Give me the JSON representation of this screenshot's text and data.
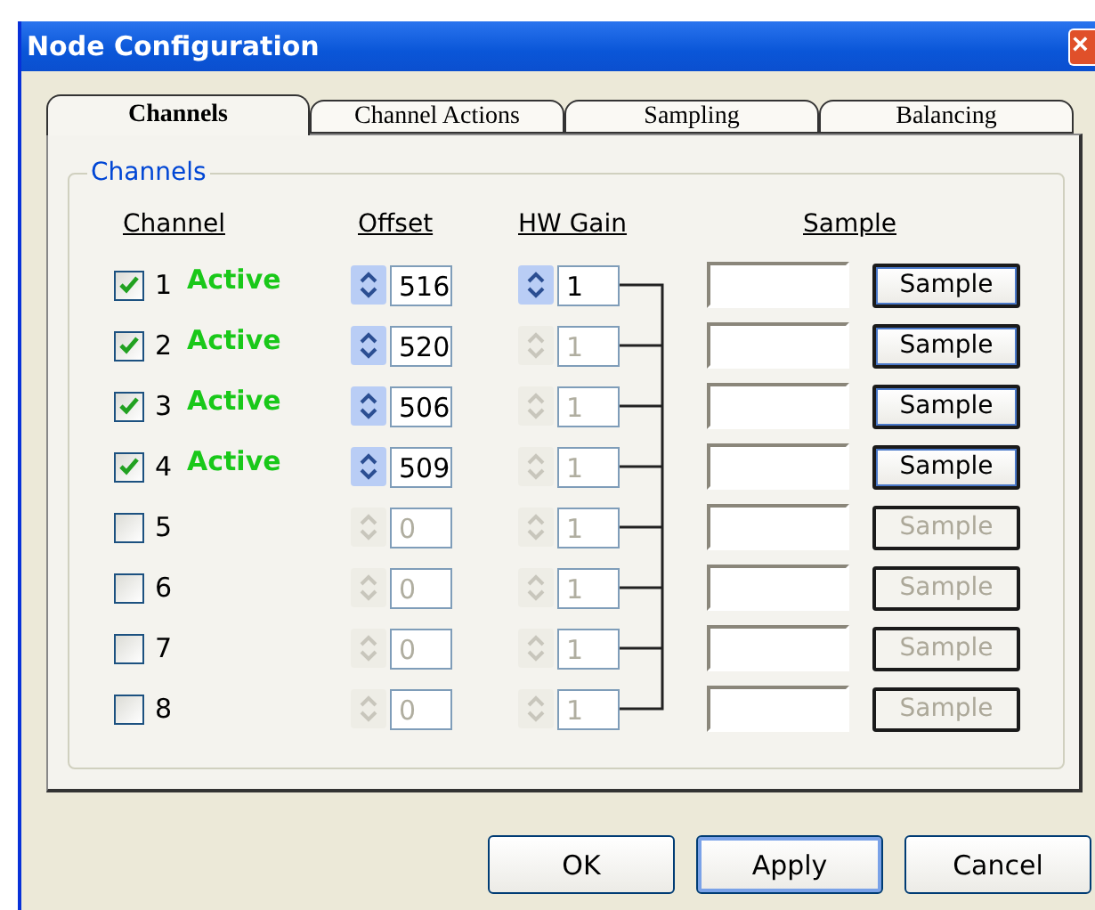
{
  "window": {
    "title": "Node Configuration",
    "close": "×"
  },
  "tabs": [
    {
      "label": "Channels",
      "selected": true
    },
    {
      "label": "Channel Actions",
      "selected": false
    },
    {
      "label": "Sampling",
      "selected": false
    },
    {
      "label": "Balancing",
      "selected": false
    }
  ],
  "group": {
    "title": "Channels",
    "columns": [
      "Channel",
      "Offset",
      "HW Gain",
      "Sample"
    ]
  },
  "channels": [
    {
      "number": "1",
      "checked": true,
      "status": "Active",
      "offset": {
        "value": "516",
        "disabled": false
      },
      "gain": {
        "value": "1",
        "disabled": false
      },
      "sample_button": {
        "label": "Sample",
        "disabled": false
      }
    },
    {
      "number": "2",
      "checked": true,
      "status": "Active",
      "offset": {
        "value": "520",
        "disabled": false
      },
      "gain": {
        "value": "1",
        "disabled": true
      },
      "sample_button": {
        "label": "Sample",
        "disabled": false
      }
    },
    {
      "number": "3",
      "checked": true,
      "status": "Active",
      "offset": {
        "value": "506",
        "disabled": false
      },
      "gain": {
        "value": "1",
        "disabled": true
      },
      "sample_button": {
        "label": "Sample",
        "disabled": false
      }
    },
    {
      "number": "4",
      "checked": true,
      "status": "Active",
      "offset": {
        "value": "509",
        "disabled": false
      },
      "gain": {
        "value": "1",
        "disabled": true
      },
      "sample_button": {
        "label": "Sample",
        "disabled": false
      }
    },
    {
      "number": "5",
      "checked": false,
      "offset": {
        "value": "0",
        "disabled": true
      },
      "gain": {
        "value": "1",
        "disabled": true
      },
      "sample_button": {
        "label": "Sample",
        "disabled": true
      }
    },
    {
      "number": "6",
      "checked": false,
      "offset": {
        "value": "0",
        "disabled": true
      },
      "gain": {
        "value": "1",
        "disabled": true
      },
      "sample_button": {
        "label": "Sample",
        "disabled": true
      }
    },
    {
      "number": "7",
      "checked": false,
      "offset": {
        "value": "0",
        "disabled": true
      },
      "gain": {
        "value": "1",
        "disabled": true
      },
      "sample_button": {
        "label": "Sample",
        "disabled": true
      }
    },
    {
      "number": "8",
      "checked": false,
      "offset": {
        "value": "0",
        "disabled": true
      },
      "gain": {
        "value": "1",
        "disabled": true
      },
      "sample_button": {
        "label": "Sample",
        "disabled": true
      }
    }
  ],
  "buttons": [
    {
      "label": "OK",
      "default": false
    },
    {
      "label": "Apply",
      "default": true
    },
    {
      "label": "Cancel",
      "default": false
    }
  ]
}
